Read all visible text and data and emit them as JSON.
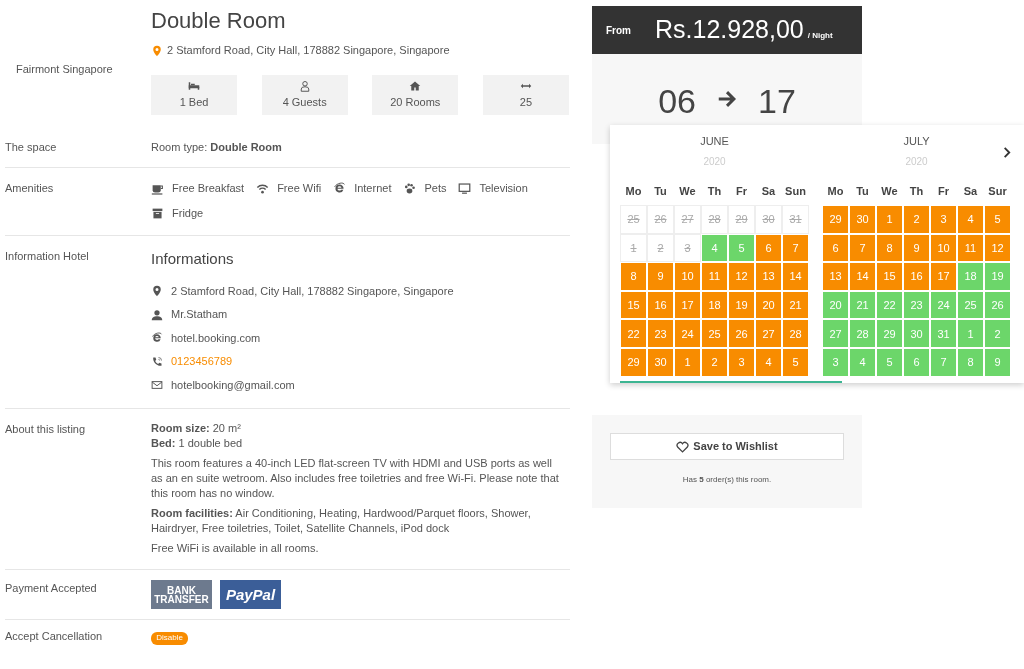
{
  "room": {
    "title": "Double Room",
    "address": "2 Stamford Road, City Hall, 178882 Singapore, Singapore",
    "hotel": "Fairmont Singapore",
    "features": [
      {
        "kind": "bed",
        "label": "1 Bed"
      },
      {
        "kind": "guests",
        "label": "4 Guests"
      },
      {
        "kind": "rooms",
        "label": "20 Rooms"
      },
      {
        "kind": "size",
        "label": "25"
      }
    ]
  },
  "space": {
    "label": "The space",
    "text": "Room type: **Double Room**"
  },
  "amenities": {
    "label": "Amenities",
    "items": [
      {
        "kind": "breakfast",
        "label": "Free Breakfast"
      },
      {
        "kind": "wifi",
        "label": "Free Wifi"
      },
      {
        "kind": "internet",
        "label": "Internet"
      },
      {
        "kind": "pets",
        "label": "Pets"
      },
      {
        "kind": "tv",
        "label": "Television"
      },
      {
        "kind": "fridge",
        "label": "Fridge"
      }
    ]
  },
  "information": {
    "label": "Information Hotel",
    "heading": "Informations",
    "items": [
      {
        "kind": "address",
        "text": "2 Stamford Road, City Hall, 178882 Singapore, Singapore"
      },
      {
        "kind": "person",
        "text": "Mr.Statham"
      },
      {
        "kind": "website",
        "text": "hotel.booking.com"
      },
      {
        "kind": "phone",
        "text": "0123456789"
      },
      {
        "kind": "email",
        "text": "hotelbooking@gmail.com"
      }
    ]
  },
  "about": {
    "label": "About this listing",
    "paragraphs": [
      {
        "text": "**Room size:** 20 m²"
      },
      {
        "text": "**Bed:** 1 double bed"
      },
      {
        "text": "This room features a 40-inch LED flat-screen TV with HDMI and USB ports as well as an en suite wetroom. Also includes free toiletries and free Wi-Fi. Please note that this room has no window."
      },
      {
        "text": "**Room facilities:** Air Conditioning, Heating, Hardwood/Parquet floors, Shower, Hairdryer, Free toiletries, Toilet, Satellite Channels, iPod dock"
      },
      {
        "text": "Free WiFi is available in all rooms."
      }
    ]
  },
  "payment": {
    "label": "Payment Accepted",
    "methods": [
      {
        "kind": "bank",
        "lines": [
          "BANK",
          "TRANSFER"
        ]
      },
      {
        "kind": "paypal",
        "lines": [
          "PayPal"
        ]
      }
    ]
  },
  "cancellation": {
    "label": "Accept Cancellation",
    "badge": "Disable"
  },
  "booking": {
    "from": "From",
    "price": "Rs.12.928,00",
    "per": "/ Night",
    "check_in": "06",
    "check_out": "17",
    "wishlist": "Save to Wishlist",
    "orders": "Has **5** order(s) this room."
  },
  "calendar": {
    "weekdays_left": [
      "Mo",
      "Tu",
      "We",
      "Th",
      "Fr",
      "Sa",
      "Sun"
    ],
    "weekdays_right": [
      "Mo",
      "Tu",
      "We",
      "Th",
      "Fr",
      "Sa",
      "Sur"
    ],
    "months": [
      {
        "name": "JUNE",
        "year": "2020",
        "weeks": [
          [
            {
              "d": "25",
              "kind": "past"
            },
            {
              "d": "26",
              "kind": "past"
            },
            {
              "d": "27",
              "kind": "past"
            },
            {
              "d": "28",
              "kind": "past"
            },
            {
              "d": "29",
              "kind": "past"
            },
            {
              "d": "30",
              "kind": "past"
            },
            {
              "d": "31",
              "kind": "past"
            }
          ],
          [
            {
              "d": "1",
              "kind": "past"
            },
            {
              "d": "2",
              "kind": "past"
            },
            {
              "d": "3",
              "kind": "past"
            },
            {
              "d": "4",
              "kind": "available"
            },
            {
              "d": "5",
              "kind": "available"
            },
            {
              "d": "6",
              "kind": "booked"
            },
            {
              "d": "7",
              "kind": "booked"
            }
          ],
          [
            {
              "d": "8",
              "kind": "booked"
            },
            {
              "d": "9",
              "kind": "booked"
            },
            {
              "d": "10",
              "kind": "booked"
            },
            {
              "d": "11",
              "kind": "booked"
            },
            {
              "d": "12",
              "kind": "booked"
            },
            {
              "d": "13",
              "kind": "booked"
            },
            {
              "d": "14",
              "kind": "booked"
            }
          ],
          [
            {
              "d": "15",
              "kind": "booked"
            },
            {
              "d": "16",
              "kind": "booked"
            },
            {
              "d": "17",
              "kind": "booked"
            },
            {
              "d": "18",
              "kind": "booked"
            },
            {
              "d": "19",
              "kind": "booked"
            },
            {
              "d": "20",
              "kind": "booked"
            },
            {
              "d": "21",
              "kind": "booked"
            }
          ],
          [
            {
              "d": "22",
              "kind": "booked"
            },
            {
              "d": "23",
              "kind": "booked"
            },
            {
              "d": "24",
              "kind": "booked"
            },
            {
              "d": "25",
              "kind": "booked"
            },
            {
              "d": "26",
              "kind": "booked"
            },
            {
              "d": "27",
              "kind": "booked"
            },
            {
              "d": "28",
              "kind": "booked"
            }
          ],
          [
            {
              "d": "29",
              "kind": "booked"
            },
            {
              "d": "30",
              "kind": "booked"
            },
            {
              "d": "1",
              "kind": "booked"
            },
            {
              "d": "2",
              "kind": "booked"
            },
            {
              "d": "3",
              "kind": "booked"
            },
            {
              "d": "4",
              "kind": "booked"
            },
            {
              "d": "5",
              "kind": "booked"
            }
          ]
        ]
      },
      {
        "name": "JULY",
        "year": "2020",
        "weeks": [
          [
            {
              "d": "29",
              "kind": "booked"
            },
            {
              "d": "30",
              "kind": "booked"
            },
            {
              "d": "1",
              "kind": "booked"
            },
            {
              "d": "2",
              "kind": "booked"
            },
            {
              "d": "3",
              "kind": "booked"
            },
            {
              "d": "4",
              "kind": "booked"
            },
            {
              "d": "5",
              "kind": "booked"
            }
          ],
          [
            {
              "d": "6",
              "kind": "booked"
            },
            {
              "d": "7",
              "kind": "booked"
            },
            {
              "d": "8",
              "kind": "booked"
            },
            {
              "d": "9",
              "kind": "booked"
            },
            {
              "d": "10",
              "kind": "booked"
            },
            {
              "d": "11",
              "kind": "booked"
            },
            {
              "d": "12",
              "kind": "booked"
            }
          ],
          [
            {
              "d": "13",
              "kind": "booked"
            },
            {
              "d": "14",
              "kind": "booked"
            },
            {
              "d": "15",
              "kind": "booked"
            },
            {
              "d": "16",
              "kind": "booked"
            },
            {
              "d": "17",
              "kind": "booked"
            },
            {
              "d": "18",
              "kind": "available"
            },
            {
              "d": "19",
              "kind": "available"
            }
          ],
          [
            {
              "d": "20",
              "kind": "available"
            },
            {
              "d": "21",
              "kind": "available"
            },
            {
              "d": "22",
              "kind": "available"
            },
            {
              "d": "23",
              "kind": "available"
            },
            {
              "d": "24",
              "kind": "available"
            },
            {
              "d": "25",
              "kind": "available"
            },
            {
              "d": "26",
              "kind": "available"
            }
          ],
          [
            {
              "d": "27",
              "kind": "available"
            },
            {
              "d": "28",
              "kind": "available"
            },
            {
              "d": "29",
              "kind": "available"
            },
            {
              "d": "30",
              "kind": "available"
            },
            {
              "d": "31",
              "kind": "available"
            },
            {
              "d": "1",
              "kind": "available"
            },
            {
              "d": "2",
              "kind": "available"
            }
          ],
          [
            {
              "d": "3",
              "kind": "available"
            },
            {
              "d": "4",
              "kind": "available"
            },
            {
              "d": "5",
              "kind": "available"
            },
            {
              "d": "6",
              "kind": "available"
            },
            {
              "d": "7",
              "kind": "available"
            },
            {
              "d": "8",
              "kind": "available"
            },
            {
              "d": "9",
              "kind": "available"
            }
          ]
        ]
      }
    ]
  }
}
